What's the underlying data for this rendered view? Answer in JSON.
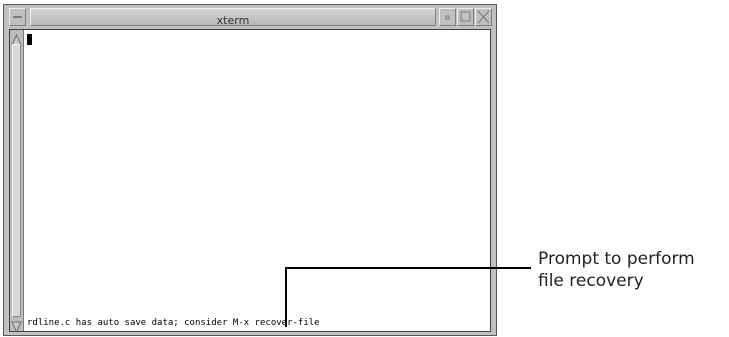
{
  "window": {
    "title": "xterm"
  },
  "terminal": {
    "status_line": "rdline.c has auto save data; consider M-x recover-file"
  },
  "callout": {
    "line1": "Prompt to perform",
    "line2": "file recovery"
  },
  "icons": {
    "window_menu": "window-menu-icon",
    "minimize": "minimize-icon",
    "maximize": "maximize-icon",
    "close": "close-icon",
    "scroll_up": "scroll-up-arrow-icon",
    "scroll_down": "scroll-down-arrow-icon"
  }
}
